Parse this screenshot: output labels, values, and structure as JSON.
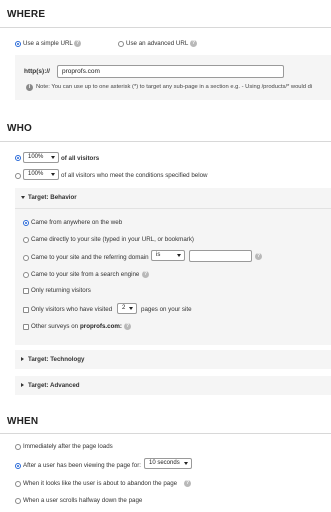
{
  "where": {
    "heading": "WHERE",
    "simple_url_label": "Use a simple URL",
    "advanced_url_label": "Use an advanced URL",
    "protocol_label": "http(s)://",
    "url_value": "proprofs.com",
    "note": "Note: You can use up to one asterisk (*) to target any sub-page in a section e.g. - Using /products/* would di"
  },
  "who": {
    "heading": "WHO",
    "option1_select": "100%",
    "option1_label": "of all visitors",
    "option2_select": "100%",
    "option2_label": "of all visitors who meet the conditions specified below",
    "behavior_panel": {
      "title": "Target: Behavior",
      "options": {
        "anywhere": "Came from anywhere on the web",
        "directly": "Came directly to your site (typed in your URL, or bookmark)",
        "referring": "Came to your site and the referring domain",
        "referring_select": "is",
        "search_engine": "Came to your site from a search engine",
        "returning": "Only returning visitors",
        "visited_prefix": "Only visitors who have visited",
        "visited_select": "2",
        "visited_suffix": "pages on your site",
        "other_prefix": "Other surveys on",
        "other_domain": "proprofs.com:"
      }
    },
    "technology_title": "Target: Technology",
    "advanced_title": "Target: Advanced"
  },
  "when": {
    "heading": "WHEN",
    "immediately": "Immediately after the page loads",
    "after_viewing": "After a user has been viewing the page for:",
    "after_select": "10 seconds",
    "abandon": "When it looks like the user is about to abandon the page",
    "scrolls": "When a user scrolls halfway down the page"
  },
  "icons": {
    "help": "?",
    "info": "i"
  },
  "colors": {
    "accent": "#2a6ad8",
    "panel_bg": "#f5f5f5"
  }
}
